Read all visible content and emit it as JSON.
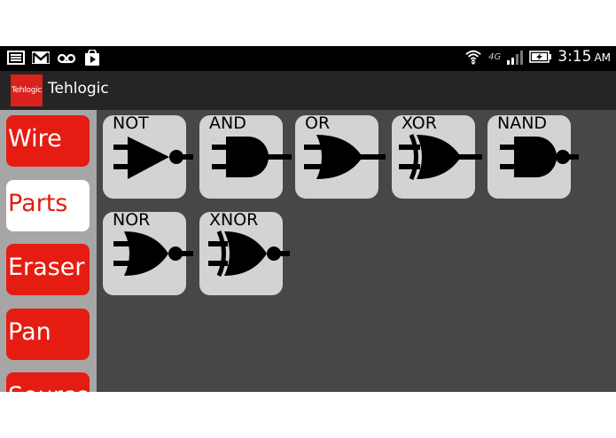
{
  "status_bar": {
    "left_icons": [
      "notification-icon",
      "gmail-icon",
      "voicemail-icon",
      "play-store-icon"
    ],
    "right_icons": [
      "wifi-icon",
      "signal-icon",
      "battery-charging-icon"
    ],
    "network_type": "4G",
    "time": "3:15",
    "ampm": "AM"
  },
  "action_bar": {
    "app_icon_text": "Tehlogic",
    "title": "Tehlogic"
  },
  "sidebar": {
    "tools": [
      {
        "label": "Wire",
        "selected": false
      },
      {
        "label": "Parts",
        "selected": true
      },
      {
        "label": "Eraser",
        "selected": false
      },
      {
        "label": "Pan",
        "selected": false
      },
      {
        "label": "Source",
        "selected": false
      }
    ]
  },
  "parts": [
    {
      "label": "NOT",
      "gate": "not"
    },
    {
      "label": "AND",
      "gate": "and"
    },
    {
      "label": "OR",
      "gate": "or"
    },
    {
      "label": "XOR",
      "gate": "xor"
    },
    {
      "label": "NAND",
      "gate": "nand"
    },
    {
      "label": "NOR",
      "gate": "nor"
    },
    {
      "label": "XNOR",
      "gate": "xnor"
    }
  ],
  "colors": {
    "accent_red": "#e51c12",
    "canvas_bg": "#464746",
    "sidebar_bg": "#a6a6a6",
    "part_tile": "#d3d3d3"
  }
}
